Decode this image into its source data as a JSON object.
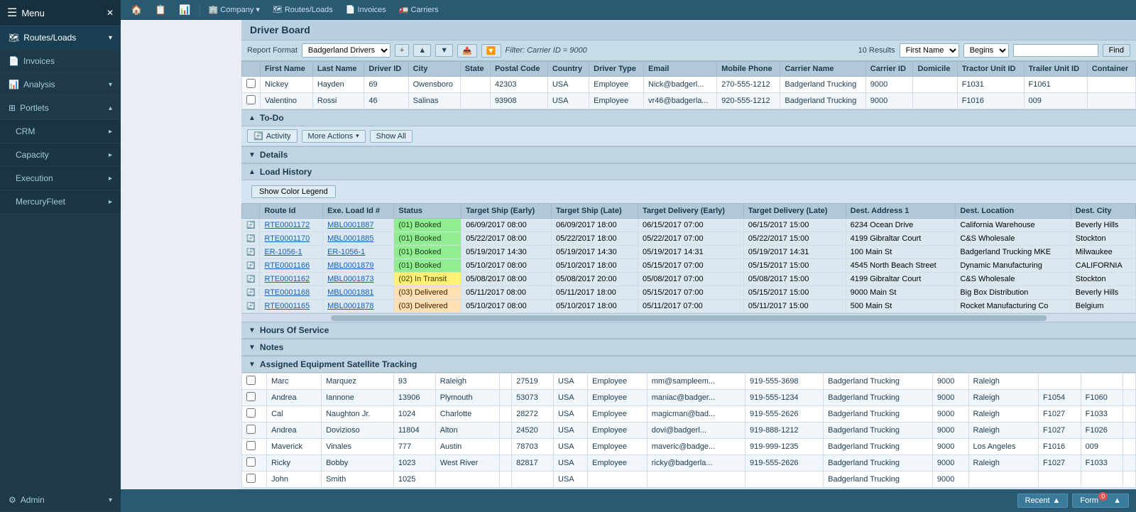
{
  "sidebar": {
    "menu_label": "Menu",
    "items": [
      {
        "id": "routes-loads",
        "label": "Routes/Loads",
        "icon": "🗺",
        "hasArrow": true,
        "active": false
      },
      {
        "id": "invoices",
        "label": "Invoices",
        "icon": "📄",
        "hasArrow": false,
        "active": false
      },
      {
        "id": "analysis",
        "label": "Analysis",
        "icon": "📊",
        "hasArrow": true,
        "active": false
      },
      {
        "id": "portlets",
        "label": "Portlets",
        "icon": "⊞",
        "hasArrow": true,
        "active": true
      },
      {
        "id": "crm",
        "label": "CRM",
        "icon": "👥",
        "hasArrow": true,
        "active": false
      },
      {
        "id": "capacity",
        "label": "Capacity",
        "icon": "📦",
        "hasArrow": true,
        "active": false
      },
      {
        "id": "execution",
        "label": "Execution",
        "icon": "▶",
        "hasArrow": true,
        "active": false
      },
      {
        "id": "mercuryfleet",
        "label": "MercuryFleet",
        "icon": "🚚",
        "hasArrow": true,
        "active": false
      },
      {
        "id": "admin",
        "label": "Admin",
        "icon": "⚙",
        "hasArrow": true,
        "active": false
      }
    ]
  },
  "topnav": {
    "items": [
      {
        "id": "home",
        "label": "",
        "icon": "🏠"
      },
      {
        "id": "nav2",
        "label": "",
        "icon": "📋"
      },
      {
        "id": "nav3",
        "label": "",
        "icon": "📊"
      },
      {
        "id": "company",
        "label": "Company",
        "icon": "🏢",
        "hasArrow": true
      },
      {
        "id": "routes-loads",
        "label": "Routes/Loads",
        "icon": "🗺"
      },
      {
        "id": "invoices",
        "label": "Invoices",
        "icon": "📄"
      },
      {
        "id": "carriers",
        "label": "Carriers",
        "icon": "🚛"
      }
    ]
  },
  "page": {
    "title": "Driver Board"
  },
  "toolbar": {
    "report_format_label": "Report Format",
    "report_format_value": "Badgerland Drivers",
    "filter_text": "Filter: Carrier ID = 9000",
    "results_label": "10 Results",
    "search_field_label": "First Name",
    "search_operator_label": "Begins",
    "find_label": "Find"
  },
  "table": {
    "columns": [
      "",
      "First Name",
      "Last Name",
      "Driver ID",
      "City",
      "State",
      "Postal Code",
      "Country",
      "Driver Type",
      "Email",
      "Mobile Phone",
      "Carrier Name",
      "Carrier ID",
      "Domicile",
      "Tractor Unit ID",
      "Trailer Unit ID",
      "Container"
    ],
    "rows": [
      {
        "check": "",
        "first": "Nickey",
        "last": "Hayden",
        "driver_id": "69",
        "city": "Owensboro",
        "state": "",
        "postal": "42303",
        "country": "USA",
        "type": "Employee",
        "email": "Nick@badgerl...",
        "mobile": "270-555-1212",
        "carrier": "Badgerland Trucking",
        "carrier_id": "9000",
        "domicile": "",
        "tractor": "F1031",
        "trailer": "F1061",
        "container": ""
      },
      {
        "check": "",
        "first": "Valentino",
        "last": "Rossi",
        "driver_id": "46",
        "city": "Salinas",
        "state": "",
        "postal": "93908",
        "country": "USA",
        "type": "Employee",
        "email": "vr46@badgerla...",
        "mobile": "920-555-1212",
        "carrier": "Badgerland Trucking",
        "carrier_id": "9000",
        "domicile": "",
        "tractor": "F1016",
        "trailer": "009",
        "container": ""
      }
    ]
  },
  "todo": {
    "title": "To-Do",
    "activity_btn": "Activity",
    "more_actions_btn": "More Actions",
    "show_all_btn": "Show All"
  },
  "details": {
    "title": "Details"
  },
  "load_history": {
    "title": "Load History",
    "show_legend_btn": "Show Color Legend",
    "columns": [
      "",
      "Route Id",
      "Exe. Load Id #",
      "Status",
      "Target Ship (Early)",
      "Target Ship (Late)",
      "Target Delivery (Early)",
      "Target Delivery (Late)",
      "Dest. Address 1",
      "Dest. Location",
      "Dest. City"
    ],
    "rows": [
      {
        "icon": "🔄",
        "route": "RTE0001172",
        "load": "MBL0001887",
        "status": "(01) Booked",
        "status_class": "status-booked",
        "ship_early": "06/09/2017 08:00",
        "ship_late": "06/09/2017 18:00",
        "del_early": "06/15/2017 07:00",
        "del_late": "06/15/2017 15:00",
        "addr": "6234 Ocean Drive",
        "location": "California Warehouse",
        "city": "Beverly Hills"
      },
      {
        "icon": "🔄",
        "route": "RTE0001170",
        "load": "MBL0001885",
        "status": "(01) Booked",
        "status_class": "status-booked",
        "ship_early": "05/22/2017 08:00",
        "ship_late": "05/22/2017 18:00",
        "del_early": "05/22/2017 07:00",
        "del_late": "05/22/2017 15:00",
        "addr": "4199 Gibraltar Court",
        "location": "C&S Wholesale",
        "city": "Stockton"
      },
      {
        "icon": "🔄",
        "route": "ER-1056-1",
        "load": "ER-1056-1",
        "status": "(01) Booked",
        "status_class": "status-booked",
        "ship_early": "05/19/2017 14:30",
        "ship_late": "05/19/2017 14:30",
        "del_early": "05/19/2017 14:31",
        "del_late": "05/19/2017 14:31",
        "addr": "100 Main St",
        "location": "Badgerland Trucking MKE",
        "city": "Milwaukee"
      },
      {
        "icon": "🔄",
        "route": "RTE0001166",
        "load": "MBL0001879",
        "status": "(01) Booked",
        "status_class": "status-booked",
        "ship_early": "05/10/2017 08:00",
        "ship_late": "05/10/2017 18:00",
        "del_early": "05/15/2017 07:00",
        "del_late": "05/15/2017 15:00",
        "addr": "4545 North Beach Street",
        "location": "Dynamic Manufacturing",
        "city": "CALIFORNIA"
      },
      {
        "icon": "🔄",
        "route": "RTE0001162",
        "load": "MBL0001873",
        "status": "(02) In Transit",
        "status_class": "status-in-transit",
        "ship_early": "05/08/2017 08:00",
        "ship_late": "05/08/2017 20:00",
        "del_early": "05/08/2017 07:00",
        "del_late": "05/08/2017 15:00",
        "addr": "4199 Gibraltar Court",
        "location": "C&S Wholesale",
        "city": "Stockton"
      },
      {
        "icon": "🔄",
        "route": "RTE0001168",
        "load": "MBL0001881",
        "status": "(03) Delivered",
        "status_class": "status-delivered",
        "ship_early": "05/11/2017 08:00",
        "ship_late": "05/11/2017 18:00",
        "del_early": "05/15/2017 07:00",
        "del_late": "05/15/2017 15:00",
        "addr": "9000 Main St",
        "location": "Big Box Distribution",
        "city": "Beverly Hills"
      },
      {
        "icon": "🔄",
        "route": "RTE0001165",
        "load": "MBL0001878",
        "status": "(03) Delivered",
        "status_class": "status-delivered",
        "ship_early": "05/10/2017 08:00",
        "ship_late": "05/10/2017 18:00",
        "del_early": "05/11/2017 07:00",
        "del_late": "05/11/2017 15:00",
        "addr": "500 Main St",
        "location": "Rocket Manufacturing Co",
        "city": "Belgium"
      }
    ]
  },
  "hours_of_service": {
    "title": "Hours Of Service"
  },
  "notes": {
    "title": "Notes"
  },
  "satellite": {
    "title": "Assigned Equipment Satellite Tracking"
  },
  "lower_table": {
    "rows": [
      {
        "check": "",
        "first": "Marc",
        "last": "Marquez",
        "driver_id": "93",
        "city": "Raleigh",
        "state": "",
        "postal": "27519",
        "country": "USA",
        "type": "Employee",
        "email": "mm@sampleem...",
        "mobile": "919-555-3698",
        "carrier": "Badgerland Trucking",
        "carrier_id": "9000",
        "domicile": "Raleigh",
        "tractor": "",
        "trailer": "",
        "container": ""
      },
      {
        "check": "",
        "first": "Andrea",
        "last": "Iannone",
        "driver_id": "13906",
        "city": "Plymouth",
        "state": "",
        "postal": "53073",
        "country": "USA",
        "type": "Employee",
        "email": "maniac@badger...",
        "mobile": "919-555-1234",
        "carrier": "Badgerland Trucking",
        "carrier_id": "9000",
        "domicile": "Raleigh",
        "tractor": "F1054",
        "trailer": "F1060",
        "container": ""
      },
      {
        "check": "",
        "first": "Cal",
        "last": "Naughton Jr.",
        "driver_id": "1024",
        "city": "Charlotte",
        "state": "",
        "postal": "28272",
        "country": "USA",
        "type": "Employee",
        "email": "magicman@bad...",
        "mobile": "919-555-2626",
        "carrier": "Badgerland Trucking",
        "carrier_id": "9000",
        "domicile": "Raleigh",
        "tractor": "F1027",
        "trailer": "F1033",
        "container": ""
      },
      {
        "check": "",
        "first": "Andrea",
        "last": "Dovizioso",
        "driver_id": "11804",
        "city": "Alton",
        "state": "",
        "postal": "24520",
        "country": "USA",
        "type": "Employee",
        "email": "dovi@badgerl...",
        "mobile": "919-888-1212",
        "carrier": "Badgerland Trucking",
        "carrier_id": "9000",
        "domicile": "Raleigh",
        "tractor": "F1027",
        "trailer": "F1026",
        "container": ""
      },
      {
        "check": "",
        "first": "Maverick",
        "last": "Vinales",
        "driver_id": "777",
        "city": "Austin",
        "state": "",
        "postal": "78703",
        "country": "USA",
        "type": "Employee",
        "email": "maveric@badge...",
        "mobile": "919-999-1235",
        "carrier": "Badgerland Trucking",
        "carrier_id": "9000",
        "domicile": "Los Angeles",
        "tractor": "F1016",
        "trailer": "009",
        "container": ""
      },
      {
        "check": "",
        "first": "Ricky",
        "last": "Bobby",
        "driver_id": "1023",
        "city": "West River",
        "state": "",
        "postal": "82817",
        "country": "USA",
        "type": "Employee",
        "email": "ricky@badgerla...",
        "mobile": "919-555-2626",
        "carrier": "Badgerland Trucking",
        "carrier_id": "9000",
        "domicile": "Raleigh",
        "tractor": "F1027",
        "trailer": "F1033",
        "container": ""
      },
      {
        "check": "",
        "first": "John",
        "last": "Smith",
        "driver_id": "1025",
        "city": "",
        "state": "",
        "postal": "",
        "country": "USA",
        "type": "",
        "email": "",
        "mobile": "",
        "carrier": "Badgerland Trucking",
        "carrier_id": "9000",
        "domicile": "",
        "tractor": "",
        "trailer": "",
        "container": ""
      }
    ]
  },
  "bottom_bar": {
    "recent_label": "Recent",
    "form_label": "Form",
    "form_badge": "0"
  },
  "colors": {
    "sidebar_bg": "#1e3a4a",
    "topnav_bg": "#2a5a72",
    "header_bg": "#b8d0e0",
    "booked_color": "#90ee90",
    "in_transit_color": "#fff176",
    "delivered_color": "#ffe0b2"
  }
}
